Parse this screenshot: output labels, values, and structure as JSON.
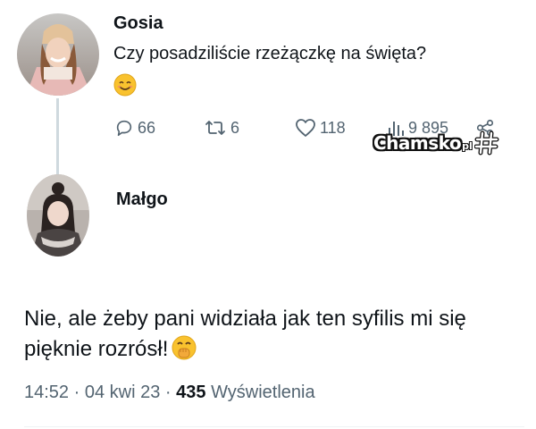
{
  "tweet": {
    "author": "Gosia",
    "text": "Czy posadziliście rzeżączkę na święta?",
    "emoji": "smiling-face-emoji",
    "actions": {
      "replies": "66",
      "retweets": "6",
      "likes": "118",
      "views": "9 895"
    }
  },
  "watermark": {
    "text": "Chamsko",
    "suffix": "pl"
  },
  "reply": {
    "author": "Małgo",
    "text": "Nie, ale żeby pani widziała jak ten syfilis mi się pięknie rozrósł!",
    "emoji": "hand-over-mouth-emoji"
  },
  "meta": {
    "time": "14:52",
    "date": "04 kwi 23",
    "views_count": "435",
    "views_label": "Wyświetlenia"
  },
  "colors": {
    "text": "#0f1419",
    "muted": "#536471",
    "thread_line": "#cfd9de",
    "emoji_yellow": "#f9c22e"
  }
}
